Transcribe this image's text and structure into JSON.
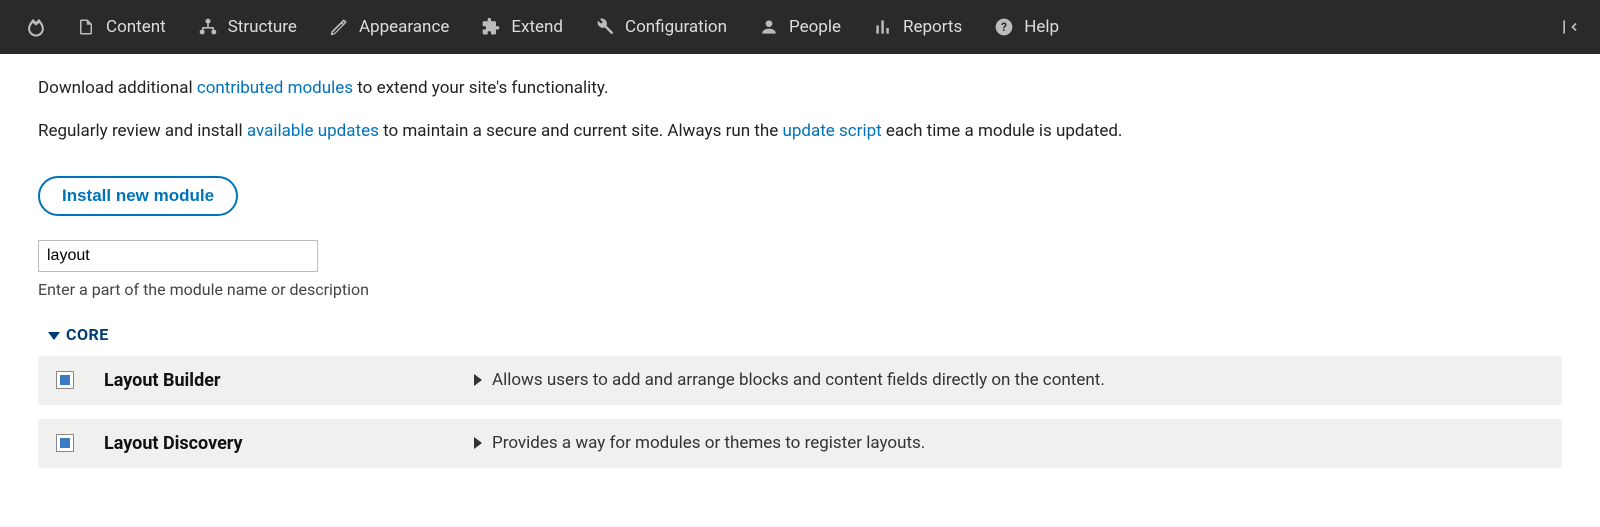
{
  "toolbar": {
    "items": [
      {
        "label": "Content",
        "icon": "content"
      },
      {
        "label": "Structure",
        "icon": "structure"
      },
      {
        "label": "Appearance",
        "icon": "appearance"
      },
      {
        "label": "Extend",
        "icon": "extend"
      },
      {
        "label": "Configuration",
        "icon": "configuration"
      },
      {
        "label": "People",
        "icon": "people"
      },
      {
        "label": "Reports",
        "icon": "reports"
      },
      {
        "label": "Help",
        "icon": "help"
      }
    ]
  },
  "intro": {
    "line1_pre": "Download additional ",
    "line1_link": "contributed modules",
    "line1_post": " to extend your site's functionality.",
    "line2_a": "Regularly review and install ",
    "line2_link1": "available updates",
    "line2_b": " to maintain a secure and current site. Always run the ",
    "line2_link2": "update script",
    "line2_c": " each time a module is updated."
  },
  "install_button": "Install new module",
  "filter": {
    "value": "layout",
    "help": "Enter a part of the module name or description"
  },
  "group_label": "CORE",
  "modules": [
    {
      "name": "Layout Builder",
      "desc": "Allows users to add and arrange blocks and content fields directly on the content.",
      "checked": true
    },
    {
      "name": "Layout Discovery",
      "desc": "Provides a way for modules or themes to register layouts.",
      "checked": true
    }
  ]
}
